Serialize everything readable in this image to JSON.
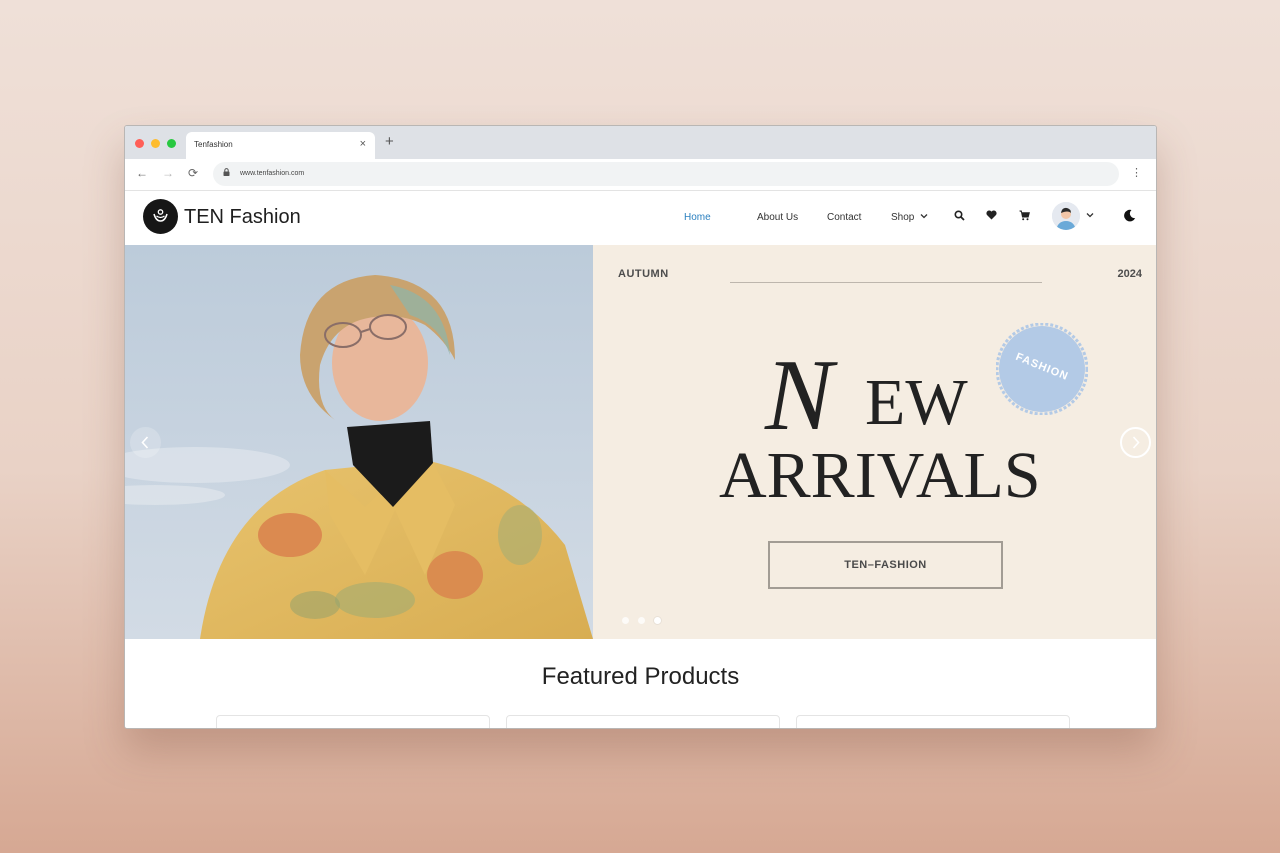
{
  "browser": {
    "tab_title": "Tenfashion",
    "tab_close": "×",
    "new_tab": "+",
    "url": "www.tenfashion.com",
    "menu_glyph": "⋮",
    "nav": {
      "back": "←",
      "forward": "→",
      "reload": "⟳"
    }
  },
  "site": {
    "brand": "TEN Fashion",
    "menu": [
      "Home",
      "About Us",
      "Contact",
      "Shop"
    ],
    "active_menu": "Home",
    "icons": [
      "search-icon",
      "heart-icon",
      "cart-icon",
      "avatar",
      "moon-icon"
    ]
  },
  "hero": {
    "season": "AUTUMN",
    "year": "2024",
    "badge": "FASHION",
    "title_initial": "N",
    "title_rest": "EW",
    "title_line2": "ARRIVALS",
    "cta": "TEN–FASHION",
    "slides": 3,
    "active_slide": 3,
    "colors": {
      "panel": "#f5ede2",
      "badge": "#b3cae6"
    }
  },
  "featured": {
    "title": "Featured Products"
  },
  "colors": {
    "accent": "#2a7fbf"
  }
}
